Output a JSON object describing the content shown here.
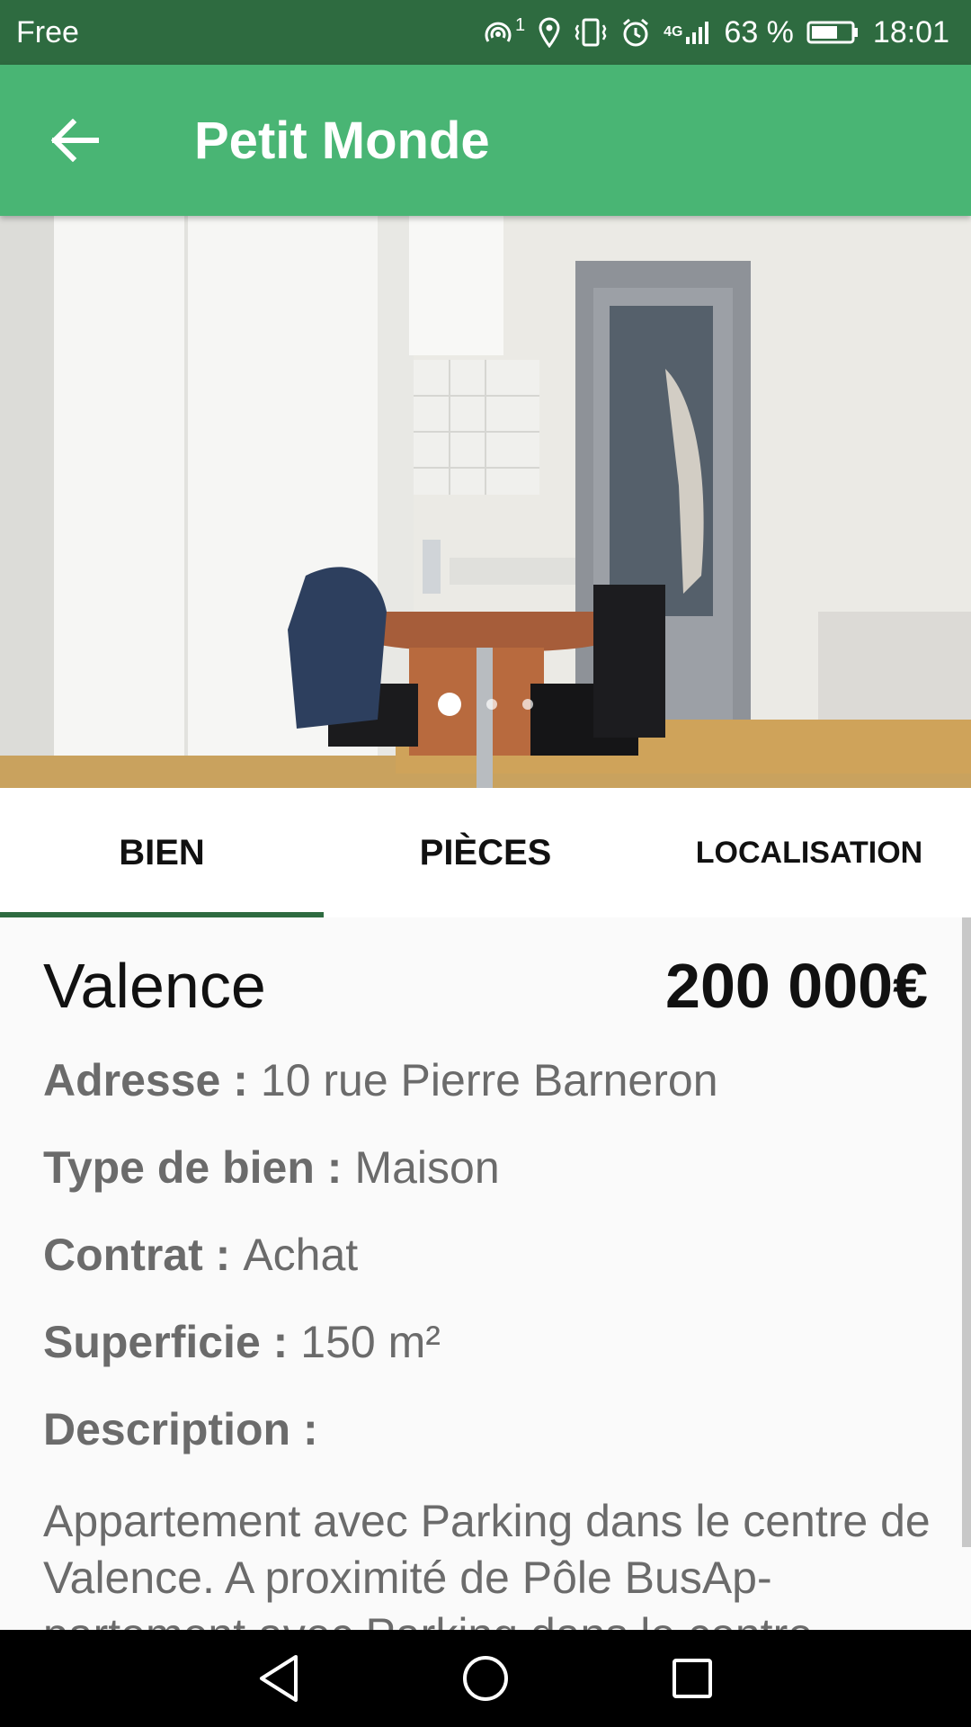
{
  "status_bar": {
    "carrier": "Free",
    "hotspot_badge": "1",
    "network": "4G",
    "battery": "63 %",
    "time": "18:01"
  },
  "app_bar": {
    "title": "Petit Monde",
    "back_icon": "arrow-back-icon"
  },
  "carousel": {
    "total": 3,
    "active_index": 0
  },
  "tabs": [
    {
      "label": "BIEN",
      "active": true
    },
    {
      "label": "PIÈCES",
      "active": false
    },
    {
      "label": "LOCALISATION",
      "active": false
    }
  ],
  "property": {
    "city": "Valence",
    "price": "200 000€",
    "fields": [
      {
        "label": "Adresse :",
        "value": "10 rue Pierre Barneron"
      },
      {
        "label": "Type de bien :",
        "value": "Maison"
      },
      {
        "label": "Contrat :",
        "value": "Achat"
      },
      {
        "label": "Superficie :",
        "value": "150 m²"
      }
    ],
    "description_label": "Description :",
    "description": "Appartement avec Parking dans le centre de Valence. A proximité de Pôle BusAp-partement avec Parking dans le centre"
  },
  "colors": {
    "status_bar": "#2e6b40",
    "app_bar": "#49b574",
    "tab_indicator": "#2e6b40"
  }
}
